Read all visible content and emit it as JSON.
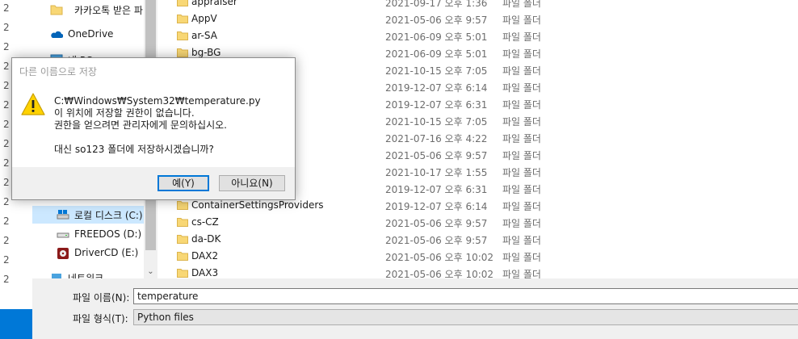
{
  "left_strip_numbers": [
    "2",
    "2",
    "2",
    "2",
    "2",
    "2",
    "2",
    "2",
    "2",
    "2",
    "2",
    "2",
    "2",
    "2",
    "2"
  ],
  "nav": {
    "items": [
      {
        "label": "카카오톡 받은 파",
        "icon": "folder-icon"
      },
      {
        "label": "OneDrive",
        "icon": "onedrive-icon"
      },
      {
        "label": "내 PC",
        "icon": "pc-icon"
      },
      {
        "label": "로컬 디스크 (C:)",
        "icon": "drive-icon"
      },
      {
        "label": "FREEDOS (D:)",
        "icon": "drive-icon"
      },
      {
        "label": "DriverCD (E:)",
        "icon": "cd-drive-icon"
      },
      {
        "label": "네트워크",
        "icon": "network-icon"
      }
    ],
    "scroll_down_glyph": "⌄"
  },
  "files": [
    {
      "name": "appraiser",
      "date": "2021-09-17 오후 1:36",
      "type": "파일 폴더"
    },
    {
      "name": "AppV",
      "date": "2021-05-06 오후 9:57",
      "type": "파일 폴더"
    },
    {
      "name": "ar-SA",
      "date": "2021-06-09 오후 5:01",
      "type": "파일 폴더"
    },
    {
      "name": "bg-BG",
      "date": "2021-06-09 오후 5:01",
      "type": "파일 폴더"
    },
    {
      "name": "",
      "date": "2021-10-15 오후 7:05",
      "type": "파일 폴더"
    },
    {
      "name": "",
      "date": "2019-12-07 오후 6:14",
      "type": "파일 폴더"
    },
    {
      "name": "",
      "date": "2019-12-07 오후 6:31",
      "type": "파일 폴더"
    },
    {
      "name": "",
      "date": "2021-10-15 오후 7:05",
      "type": "파일 폴더"
    },
    {
      "name": "",
      "date": "2021-07-16 오후 4:22",
      "type": "파일 폴더"
    },
    {
      "name": "",
      "date": "2021-05-06 오후 9:57",
      "type": "파일 폴더"
    },
    {
      "name": "",
      "date": "2021-10-17 오후 1:55",
      "type": "파일 폴더"
    },
    {
      "name": "",
      "date": "2019-12-07 오후 6:31",
      "type": "파일 폴더"
    },
    {
      "name": "ContainerSettingsProviders",
      "date": "2019-12-07 오후 6:14",
      "type": "파일 폴더"
    },
    {
      "name": "cs-CZ",
      "date": "2021-05-06 오후 9:57",
      "type": "파일 폴더"
    },
    {
      "name": "da-DK",
      "date": "2021-05-06 오후 9:57",
      "type": "파일 폴더"
    },
    {
      "name": "DAX2",
      "date": "2021-05-06 오후 10:02",
      "type": "파일 폴더"
    },
    {
      "name": "DAX3",
      "date": "2021-05-06 오후 10:02",
      "type": "파일 폴더"
    }
  ],
  "bottom": {
    "filename_label": "파일 이름(N):",
    "filename_value": "temperature",
    "filetype_label": "파일 형식(T):",
    "filetype_value": "Python files"
  },
  "dialog": {
    "title": "다른 이름으로 저장",
    "icon": "warning-icon",
    "lines": [
      "C:₩Windows₩System32₩temperature.py",
      "이 위치에 저장할 권한이 없습니다.",
      "권한을 얻으려면 관리자에게 문의하십시오.",
      "",
      "대신 so123 폴더에 저장하시겠습니까?"
    ],
    "yes_label": "예(Y)",
    "no_label": "아니요(N)"
  },
  "colors": {
    "accent": "#0078d7",
    "selection": "#cce8ff",
    "folder": "#f8d775"
  }
}
